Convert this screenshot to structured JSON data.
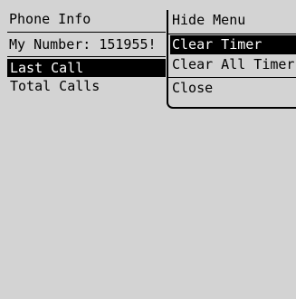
{
  "screen": {
    "title": "Phone Info",
    "my_number": "My Number: 151955!",
    "list": [
      {
        "label": "Last Call",
        "selected": true
      },
      {
        "label": "Total Calls",
        "selected": false
      }
    ]
  },
  "menu": {
    "items": [
      {
        "label": "Hide Menu",
        "selected": false
      },
      {
        "label": "Clear Timer",
        "selected": true
      },
      {
        "label": "Clear All Timers",
        "selected": false
      },
      {
        "label": "Close",
        "selected": false
      }
    ]
  },
  "colors": {
    "background": "#d3d3d3",
    "highlight": "#000000",
    "highlight_text": "#ffffff"
  }
}
